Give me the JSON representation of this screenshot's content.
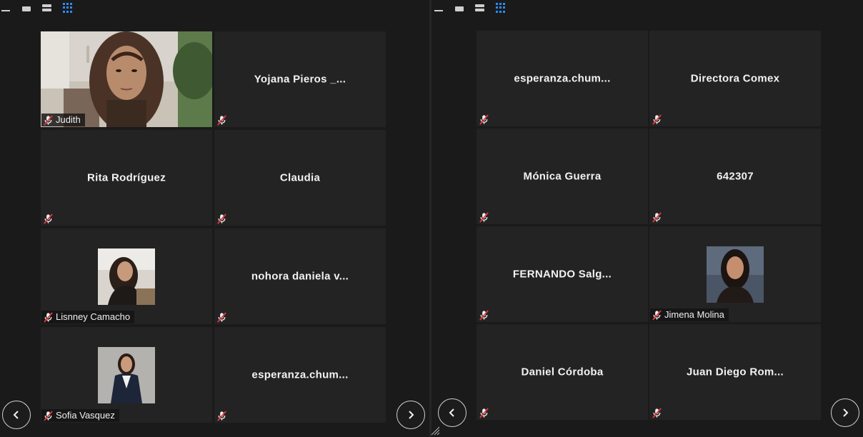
{
  "left_panel": {
    "tiles": [
      {
        "name": "Judith",
        "type": "video"
      },
      {
        "name": "Yojana  Pieros _..."
      },
      {
        "name": "Rita Rodríguez"
      },
      {
        "name": "Claudia"
      },
      {
        "name": "Lisnney Camacho",
        "type": "photo"
      },
      {
        "name": "nohora  daniela  v..."
      },
      {
        "name": "Sofia Vasquez",
        "type": "photo"
      },
      {
        "name": "esperanza.chum..."
      }
    ]
  },
  "right_panel": {
    "tiles": [
      {
        "name": "esperanza.chum..."
      },
      {
        "name": "Directora Comex"
      },
      {
        "name": "Mónica Guerra"
      },
      {
        "name": "642307"
      },
      {
        "name": "FERNANDO  Salg..."
      },
      {
        "name": "Jimena Molina",
        "type": "photo"
      },
      {
        "name": "Daniel Córdoba"
      },
      {
        "name": "Juan  Diego  Rom..."
      }
    ]
  },
  "toolbar_icons": [
    "minimize-icon",
    "thumbnail-strip-icon",
    "speaker-view-icon",
    "gallery-view-icon"
  ],
  "colors": {
    "background": "#1a1a1a",
    "tile": "#232323",
    "accent": "#2d8cff",
    "muted_mic": "#e0393e"
  }
}
